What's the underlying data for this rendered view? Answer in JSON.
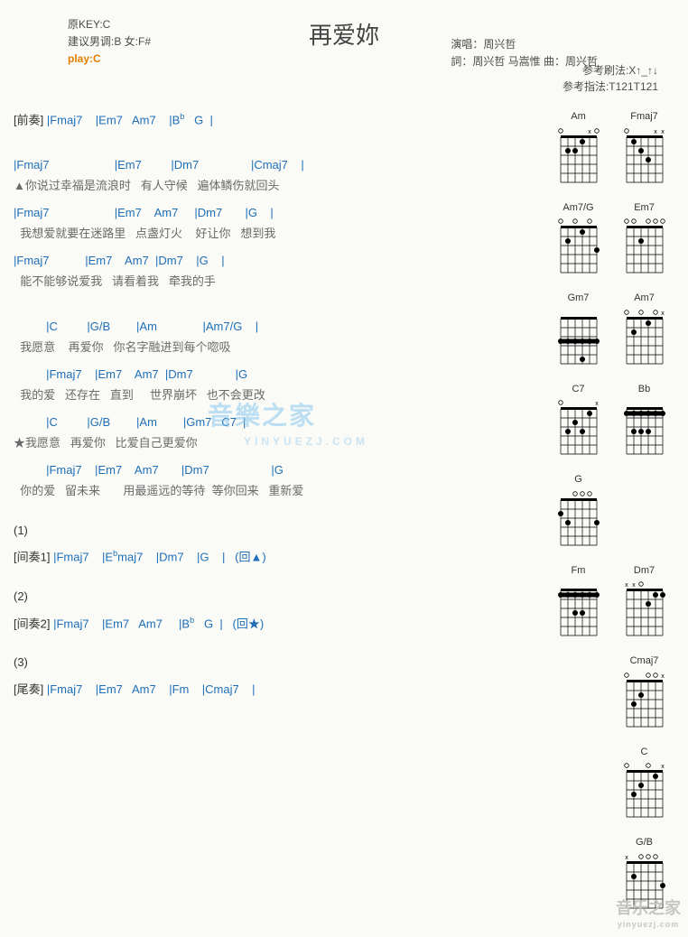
{
  "title": "再爱妳",
  "meta_left": {
    "key": "原KEY:C",
    "suggest": "建议男调:B 女:F#",
    "play": "play:C"
  },
  "meta_right": {
    "singer": "演唱：周兴哲",
    "credits": "詞：周兴哲 马嵩惟   曲：周兴哲"
  },
  "patterns": {
    "strum": "参考刷法:X↑_↑↓",
    "finger": "参考指法:T121T121"
  },
  "sections": [
    {
      "type": "chordline",
      "pre": "[前奏] ",
      "text": "|Fmaj7    |Em7   Am7    |B♭   G  |"
    },
    {
      "type": "spacer"
    },
    {
      "type": "chordline",
      "text": "|Fmaj7                    |Em7         |Dm7                |Cmaj7    |"
    },
    {
      "type": "lyric",
      "text": "▲你说过幸福是流浪时   有人守候   遍体鳞伤就回头"
    },
    {
      "type": "chordline",
      "text": "|Fmaj7                    |Em7    Am7     |Dm7       |G    |"
    },
    {
      "type": "lyric",
      "text": "  我想爱就要在迷路里   点盏灯火    好让你   想到我"
    },
    {
      "type": "chordline",
      "text": "|Fmaj7           |Em7    Am7  |Dm7    |G    |"
    },
    {
      "type": "lyric",
      "text": "  能不能够说爱我   请看着我   牵我的手"
    },
    {
      "type": "spacer"
    },
    {
      "type": "chordline",
      "text": "          |C         |G/B        |Am              |Am7/G    |"
    },
    {
      "type": "lyric",
      "text": "  我愿意    再爱你   你名字融进到每个唿吸"
    },
    {
      "type": "chordline",
      "text": "          |Fmaj7    |Em7    Am7  |Dm7             |G"
    },
    {
      "type": "lyric",
      "text": "  我的爱   还存在   直到     世界崩坏   也不会更改"
    },
    {
      "type": "chordline",
      "text": "          |C         |G/B        |Am        |Gm7   C7  |"
    },
    {
      "type": "lyric",
      "text": "★我愿意   再爱你   比爱自己更爱你"
    },
    {
      "type": "chordline",
      "text": "          |Fmaj7    |Em7    Am7       |Dm7                   |G"
    },
    {
      "type": "lyric",
      "text": "  你的爱   留未来       用最遥远的等待  等你回来   重新爱"
    },
    {
      "type": "spacer"
    },
    {
      "type": "repeat",
      "text": "(1)"
    },
    {
      "type": "chordline",
      "pre": "[间奏1] ",
      "text": "|Fmaj7    |E♭maj7    |Dm7    |G    |   (回▲)"
    },
    {
      "type": "spacer"
    },
    {
      "type": "repeat",
      "text": "(2)"
    },
    {
      "type": "chordline",
      "pre": "[间奏2] ",
      "text": "|Fmaj7    |Em7   Am7     |B♭   G  |   (回★)"
    },
    {
      "type": "spacer"
    },
    {
      "type": "repeat",
      "text": "(3)"
    },
    {
      "type": "chordline",
      "pre": "[尾奏] ",
      "text": "|Fmaj7    |Em7   Am7    |Fm    |Cmaj7    |"
    }
  ],
  "chord_diagrams": [
    {
      "name": "Am",
      "dots": [
        [
          2,
          2
        ],
        [
          3,
          2
        ],
        [
          4,
          1
        ]
      ],
      "open": [
        1,
        6
      ],
      "x": [
        5
      ]
    },
    {
      "name": "Fmaj7",
      "dots": [
        [
          2,
          1
        ],
        [
          3,
          2
        ],
        [
          4,
          3
        ]
      ],
      "open": [
        1
      ],
      "x": [
        5,
        6
      ]
    },
    {
      "name": "Am7/G",
      "dots": [
        [
          2,
          2
        ],
        [
          4,
          1
        ],
        [
          6,
          3
        ]
      ],
      "open": [
        1,
        3,
        5
      ],
      "x": []
    },
    {
      "name": "Em7",
      "dots": [
        [
          3,
          2
        ]
      ],
      "open": [
        1,
        2,
        4,
        5,
        6
      ],
      "x": []
    },
    {
      "name": "Gm7",
      "dots": [
        [
          1,
          3
        ],
        [
          2,
          3
        ],
        [
          3,
          3
        ],
        [
          4,
          3
        ],
        [
          5,
          3
        ],
        [
          6,
          3
        ],
        [
          4,
          5
        ]
      ],
      "barre": 3,
      "open": [],
      "x": []
    },
    {
      "name": "Am7",
      "dots": [
        [
          2,
          2
        ],
        [
          4,
          1
        ]
      ],
      "open": [
        1,
        3,
        5
      ],
      "x": [
        6
      ]
    },
    {
      "name": "C7",
      "dots": [
        [
          2,
          3
        ],
        [
          3,
          2
        ],
        [
          4,
          3
        ],
        [
          5,
          1
        ]
      ],
      "open": [
        1
      ],
      "x": [
        6
      ]
    },
    {
      "name": "Bb",
      "dots": [
        [
          1,
          1
        ],
        [
          2,
          1
        ],
        [
          3,
          1
        ],
        [
          4,
          1
        ],
        [
          5,
          1
        ],
        [
          6,
          1
        ],
        [
          2,
          3
        ],
        [
          3,
          3
        ],
        [
          4,
          3
        ]
      ],
      "barre": 1,
      "open": [],
      "x": []
    },
    {
      "name": "G",
      "dots": [
        [
          1,
          2
        ],
        [
          2,
          3
        ],
        [
          6,
          3
        ]
      ],
      "open": [
        3,
        4,
        5
      ],
      "x": []
    },
    {
      "name": "",
      "empty": true
    },
    {
      "name": "Fm",
      "dots": [
        [
          1,
          1
        ],
        [
          2,
          1
        ],
        [
          3,
          1
        ],
        [
          4,
          1
        ],
        [
          5,
          1
        ],
        [
          6,
          1
        ],
        [
          3,
          3
        ],
        [
          4,
          3
        ]
      ],
      "barre": 1,
      "open": [],
      "x": []
    },
    {
      "name": "Dm7",
      "dots": [
        [
          4,
          2
        ],
        [
          5,
          1
        ],
        [
          6,
          1
        ]
      ],
      "open": [
        3
      ],
      "x": [
        1,
        2
      ]
    },
    {
      "name": "",
      "empty": true
    },
    {
      "name": "Cmaj7",
      "dots": [
        [
          2,
          3
        ],
        [
          3,
          2
        ]
      ],
      "open": [
        1,
        4,
        5
      ],
      "x": [
        6
      ]
    },
    {
      "name": "",
      "empty": true
    },
    {
      "name": "C",
      "dots": [
        [
          2,
          3
        ],
        [
          3,
          2
        ],
        [
          5,
          1
        ]
      ],
      "open": [
        1,
        4
      ],
      "x": [
        6
      ]
    },
    {
      "name": "",
      "empty": true
    },
    {
      "name": "G/B",
      "dots": [
        [
          2,
          2
        ],
        [
          6,
          3
        ]
      ],
      "open": [
        3,
        4,
        5
      ],
      "x": [
        1
      ]
    }
  ],
  "watermark_main": "音樂之家",
  "watermark_sub": "YINYUEZJ.COM",
  "logo_main": "音乐之家",
  "logo_sub": "yinyuezj.com"
}
